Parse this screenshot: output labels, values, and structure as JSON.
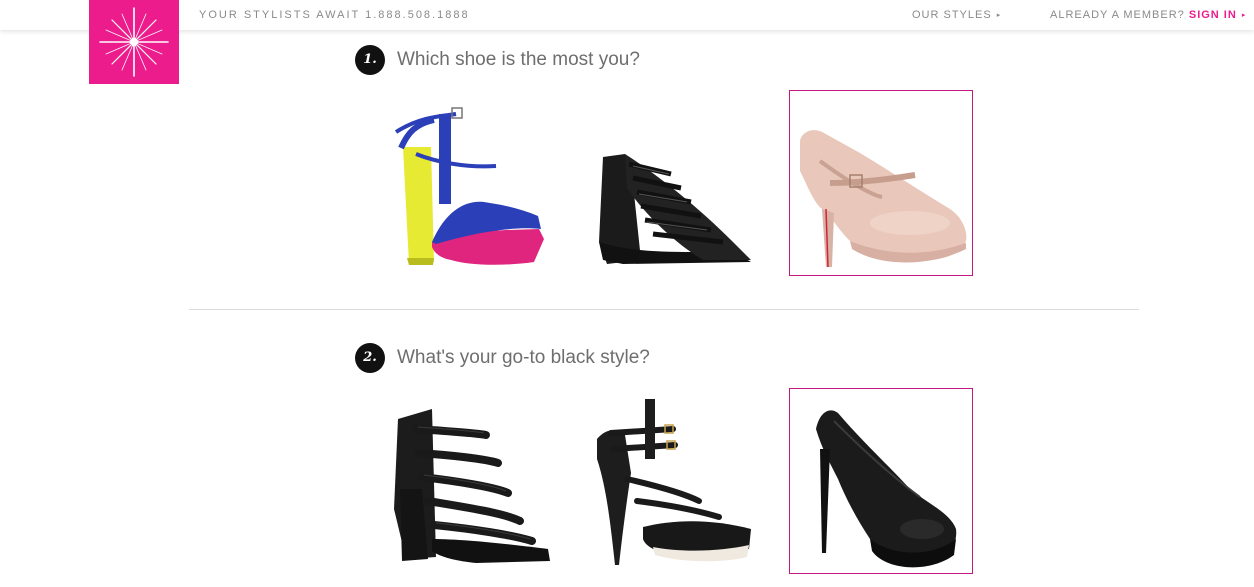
{
  "header": {
    "tagline": "YOUR STYLISTS AWAIT 1.888.508.1888",
    "our_styles": "OUR STYLES",
    "member_prompt": "ALREADY A MEMBER?",
    "sign_in": "SIGN IN",
    "arrow": "▸"
  },
  "brand": {
    "accent": "#ec1c8c",
    "selected_border": "#c2187f",
    "logo_icon": "sparkle-star-icon"
  },
  "quiz": {
    "questions": [
      {
        "number": "1.",
        "text": "Which shoe is the most you?",
        "options": [
          {
            "name": "colorblock-platform-sandal",
            "selected": false
          },
          {
            "name": "black-caged-wedge-sandal",
            "selected": false
          },
          {
            "name": "nude-mary-jane-pump",
            "selected": true
          }
        ]
      },
      {
        "number": "2.",
        "text": "What's your go-to black style?",
        "options": [
          {
            "name": "black-strappy-block-heel",
            "selected": false
          },
          {
            "name": "black-strappy-platform-heel",
            "selected": false
          },
          {
            "name": "black-platform-pump",
            "selected": true
          }
        ]
      }
    ]
  }
}
